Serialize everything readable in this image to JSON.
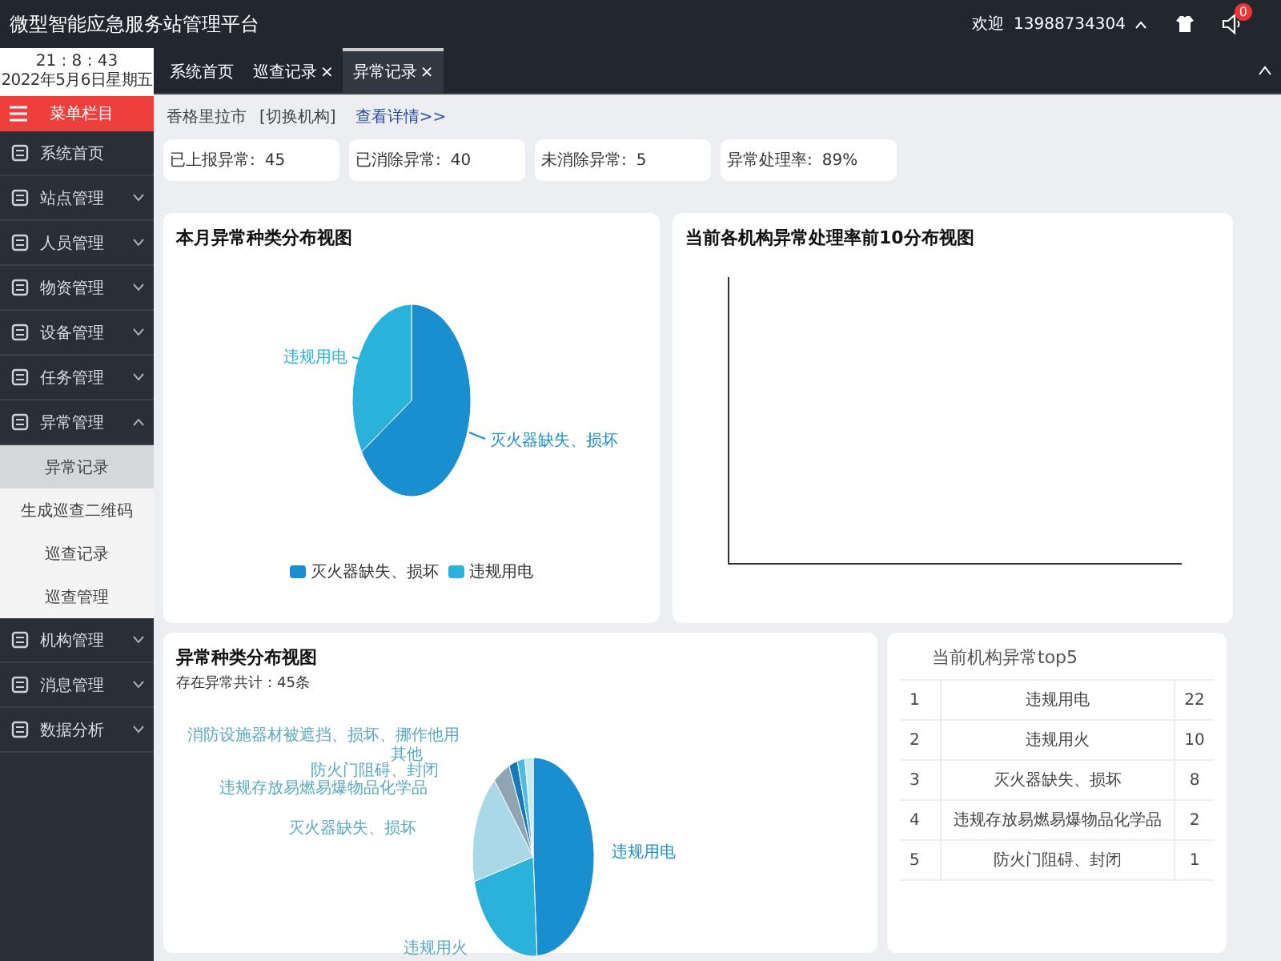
{
  "header": {
    "title": "微型智能应急服务站管理平台",
    "welcome": "欢迎",
    "user": "13988734304",
    "notification_count": "0"
  },
  "clock": {
    "time": "21 : 8 : 43",
    "date": "2022年5月6日星期五"
  },
  "sidebar": {
    "menu_title": "菜单栏目",
    "items": [
      {
        "label": "系统首页"
      },
      {
        "label": "站点管理",
        "expanded": false
      },
      {
        "label": "人员管理",
        "expanded": false
      },
      {
        "label": "物资管理",
        "expanded": false
      },
      {
        "label": "设备管理",
        "expanded": false
      },
      {
        "label": "任务管理",
        "expanded": false
      },
      {
        "label": "异常管理",
        "expanded": true,
        "children": [
          {
            "label": "异常记录",
            "selected": true
          },
          {
            "label": "生成巡查二维码",
            "selected": false
          },
          {
            "label": "巡查记录",
            "selected": false
          },
          {
            "label": "巡查管理",
            "selected": false
          }
        ]
      },
      {
        "label": "机构管理",
        "expanded": false
      },
      {
        "label": "消息管理",
        "expanded": false
      },
      {
        "label": "数据分析",
        "expanded": false
      }
    ]
  },
  "tabs": [
    {
      "label": "系统首页",
      "selected": false
    },
    {
      "label": "巡查记录",
      "close": "×",
      "selected": false
    },
    {
      "label": "异常记录",
      "close": "×",
      "selected": true
    }
  ],
  "breadcrumb": {
    "city": "香格里拉市",
    "switch": "[切换机构]",
    "details": "查看详情>>"
  },
  "stats": [
    {
      "label": "已上报异常:",
      "value": "45"
    },
    {
      "label": "已消除异常:",
      "value": "40"
    },
    {
      "label": "未消除异常:",
      "value": "5"
    },
    {
      "label": "异常处理率:",
      "value": "89%"
    }
  ],
  "month_pie": {
    "title": "本月异常种类分布视图",
    "slice_labels": [
      "违规用电",
      "灭火器缺失、损坏"
    ],
    "legend": [
      {
        "label": "灭火器缺失、损坏",
        "color": "#1a8fcf"
      },
      {
        "label": "违规用电",
        "color": "#2ab2da"
      }
    ]
  },
  "rate_chart": {
    "title": "当前各机构异常处理率前10分布视图"
  },
  "type_pie": {
    "title": "异常种类分布视图",
    "subtitle": "存在异常共计：45条",
    "slice_labels": [
      "消防设施器材被遮挡、损坏、挪作他用",
      "其他",
      "防火门阻碍、封闭",
      "违规存放易燃易爆物品化学品",
      "灭火器缺失、损坏",
      "违规用电",
      "违规用火"
    ]
  },
  "top5": {
    "title": "当前机构异常top5",
    "rows": [
      {
        "rank": "1",
        "name": "违规用电",
        "count": "22"
      },
      {
        "rank": "2",
        "name": "违规用火",
        "count": "10"
      },
      {
        "rank": "3",
        "name": "灭火器缺失、损坏",
        "count": "8"
      },
      {
        "rank": "4",
        "name": "违规存放易燃易爆物品化学品",
        "count": "2"
      },
      {
        "rank": "5",
        "name": "防火门阻碍、封闭",
        "count": "1"
      }
    ]
  }
}
